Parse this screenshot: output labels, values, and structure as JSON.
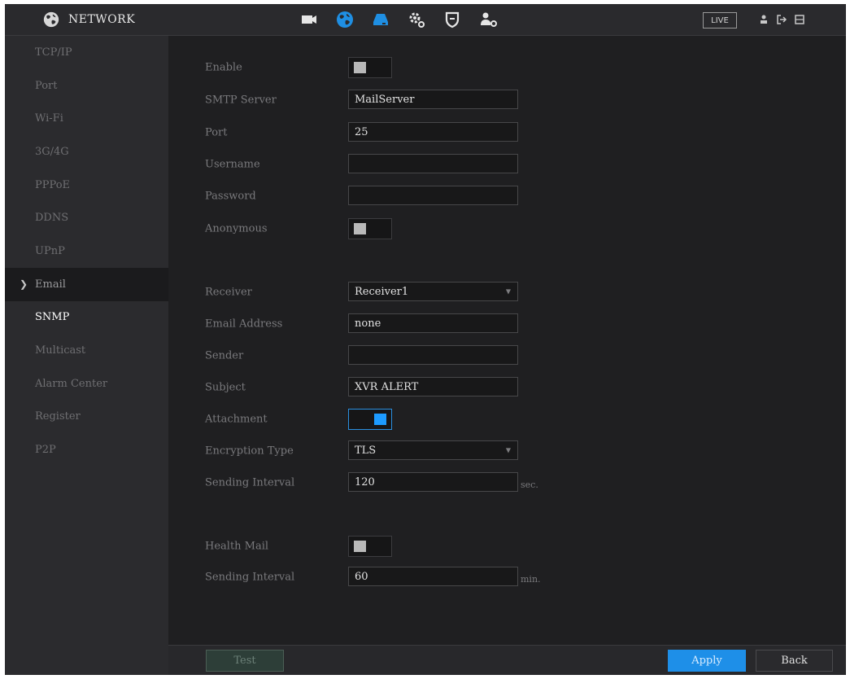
{
  "header": {
    "title": "NETWORK",
    "live_label": "LIVE",
    "nav_icons": [
      "camera-icon",
      "network-globe-icon",
      "storage-icon",
      "system-settings-icon",
      "security-shield-icon",
      "account-settings-icon"
    ],
    "right_icons": [
      "user-icon",
      "logout-icon",
      "layout-icon"
    ]
  },
  "sidebar": {
    "items": [
      {
        "label": "TCP/IP"
      },
      {
        "label": "Port"
      },
      {
        "label": "Wi-Fi"
      },
      {
        "label": "3G/4G"
      },
      {
        "label": "PPPoE"
      },
      {
        "label": "DDNS"
      },
      {
        "label": "UPnP"
      },
      {
        "label": "Email",
        "active": true
      },
      {
        "label": "SNMP"
      },
      {
        "label": "Multicast"
      },
      {
        "label": "Alarm Center"
      },
      {
        "label": "Register"
      },
      {
        "label": "P2P"
      }
    ]
  },
  "form": {
    "enable": {
      "label": "Enable",
      "on": false
    },
    "smtp_server": {
      "label": "SMTP Server",
      "value": "MailServer"
    },
    "port": {
      "label": "Port",
      "value": "25"
    },
    "username": {
      "label": "Username",
      "value": ""
    },
    "password": {
      "label": "Password",
      "value": ""
    },
    "anonymous": {
      "label": "Anonymous",
      "on": false
    },
    "receiver": {
      "label": "Receiver",
      "value": "Receiver1"
    },
    "email_address": {
      "label": "Email Address",
      "value": "none"
    },
    "sender": {
      "label": "Sender",
      "value": ""
    },
    "subject": {
      "label": "Subject",
      "value": "XVR ALERT"
    },
    "attachment": {
      "label": "Attachment",
      "on": true
    },
    "encryption_type": {
      "label": "Encryption Type",
      "value": "TLS"
    },
    "sending_interval": {
      "label": "Sending Interval",
      "value": "120",
      "unit": "sec."
    },
    "health_mail": {
      "label": "Health Mail",
      "on": false
    },
    "health_interval": {
      "label": "Sending Interval",
      "value": "60",
      "unit": "min."
    }
  },
  "footer": {
    "test_label": "Test",
    "apply_label": "Apply",
    "back_label": "Back"
  },
  "colors": {
    "accent": "#1e8fe8",
    "background": "#1f1f21",
    "sidebar": "#2b2b2e"
  }
}
